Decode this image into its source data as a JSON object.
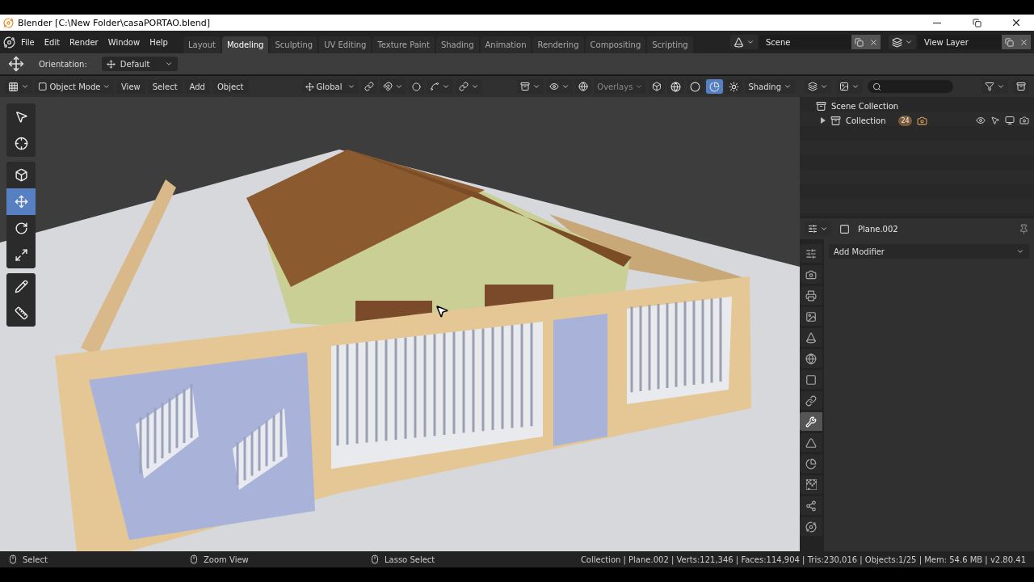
{
  "window": {
    "title": "Blender [C:\\New Folder\\casaPORTAO.blend]"
  },
  "menu": [
    "File",
    "Edit",
    "Render",
    "Window",
    "Help"
  ],
  "workspaces": [
    {
      "label": "Layout",
      "selected": false
    },
    {
      "label": "Modeling",
      "selected": true
    },
    {
      "label": "Sculpting",
      "selected": false
    },
    {
      "label": "UV Editing",
      "selected": false
    },
    {
      "label": "Texture Paint",
      "selected": false
    },
    {
      "label": "Shading",
      "selected": false
    },
    {
      "label": "Animation",
      "selected": false
    },
    {
      "label": "Rendering",
      "selected": false
    },
    {
      "label": "Compositing",
      "selected": false
    },
    {
      "label": "Scripting",
      "selected": false
    }
  ],
  "scene": {
    "value": "Scene"
  },
  "view_layer": {
    "value": "View Layer"
  },
  "tool_settings": {
    "label": "Orientation:",
    "value": "Default"
  },
  "viewport_header": {
    "mode": "Object Mode",
    "menus": [
      "View",
      "Select",
      "Add",
      "Object"
    ],
    "orientation": "Global",
    "overlays": "Overlays",
    "shading": "Shading",
    "shading_modes": [
      {
        "kind": "wireframe",
        "selected": false
      },
      {
        "kind": "solid",
        "selected": false
      },
      {
        "kind": "material",
        "selected": true
      },
      {
        "kind": "rendered",
        "selected": false
      }
    ]
  },
  "toolbar": [
    [
      {
        "kind": "select",
        "selected": false
      },
      {
        "kind": "cursor",
        "selected": false
      }
    ],
    [
      {
        "kind": "transform",
        "selected": false
      },
      {
        "kind": "move",
        "selected": true
      },
      {
        "kind": "rotate",
        "selected": false
      },
      {
        "kind": "scale",
        "selected": false
      }
    ],
    [
      {
        "kind": "annotate",
        "selected": false
      },
      {
        "kind": "measure",
        "selected": false
      }
    ]
  ],
  "outliner": {
    "items": [
      {
        "label": "Scene Collection",
        "children": [
          {
            "label": "Collection",
            "expanded": false,
            "badge": "24"
          }
        ]
      }
    ]
  },
  "properties": {
    "object": "Plane.002",
    "button": "Add Modifier",
    "tabs": [
      {
        "kind": "tool",
        "selected": false
      },
      {
        "kind": "render",
        "selected": false
      },
      {
        "kind": "output",
        "selected": false
      },
      {
        "kind": "view_layer",
        "selected": false
      },
      {
        "kind": "scene",
        "selected": false
      },
      {
        "kind": "world",
        "selected": false
      },
      {
        "kind": "object",
        "selected": false
      },
      {
        "kind": "constraints",
        "selected": false
      },
      {
        "kind": "modifiers",
        "selected": true
      },
      {
        "kind": "data",
        "selected": false
      },
      {
        "kind": "material",
        "selected": false
      },
      {
        "kind": "texture",
        "selected": false
      },
      {
        "kind": "particles",
        "selected": false
      },
      {
        "kind": "physics",
        "selected": false
      }
    ]
  },
  "status_bar": {
    "hints": [
      "Select",
      "Zoom View",
      "Lasso Select"
    ],
    "stats": "Collection | Plane.002 | Verts:121,346 | Faces:114,904 | Tris:230,016 | Objects:1/25 | Mem: 54.6 MB | v2.80.41"
  }
}
